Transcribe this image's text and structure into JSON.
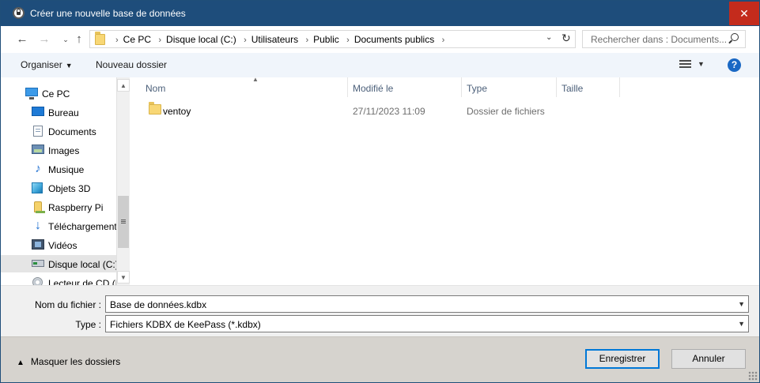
{
  "window": {
    "title": "Créer une nouvelle base de données",
    "close_glyph": "✕"
  },
  "nav": {
    "back_glyph": "←",
    "forward_glyph": "→",
    "up_glyph": "↑",
    "breadcrumbs": [
      "Ce PC",
      "Disque local (C:)",
      "Utilisateurs",
      "Public",
      "Documents publics"
    ],
    "search_placeholder": "Rechercher dans : Documents..."
  },
  "toolbar": {
    "organize_label": "Organiser",
    "new_folder_label": "Nouveau dossier",
    "help_glyph": "?"
  },
  "sidebar": {
    "items": [
      {
        "label": "Ce PC",
        "icon": "pc-icon"
      },
      {
        "label": "Bureau",
        "icon": "desktop-icon"
      },
      {
        "label": "Documents",
        "icon": "documents-icon"
      },
      {
        "label": "Images",
        "icon": "images-icon"
      },
      {
        "label": "Musique",
        "icon": "music-icon"
      },
      {
        "label": "Objets 3D",
        "icon": "objects-3d-icon"
      },
      {
        "label": "Raspberry Pi",
        "icon": "raspberry-pi-icon"
      },
      {
        "label": "Téléchargements",
        "icon": "downloads-icon"
      },
      {
        "label": "Vidéos",
        "icon": "videos-icon"
      },
      {
        "label": "Disque local (C:)",
        "icon": "hard-drive-icon",
        "selected": true
      },
      {
        "label": "Lecteur de CD (D",
        "icon": "cd-drive-icon"
      }
    ]
  },
  "filelist": {
    "columns": [
      "Nom",
      "Modifié le",
      "Type",
      "Taille"
    ],
    "rows": [
      {
        "name": "ventoy",
        "modified": "27/11/2023 11:09",
        "type": "Dossier de fichiers",
        "size": ""
      }
    ]
  },
  "form": {
    "filename_label": "Nom du fichier :",
    "filename_value": "Base de données.kdbx",
    "type_label": "Type :",
    "type_value": "Fichiers KDBX de KeePass (*.kdbx)"
  },
  "footer": {
    "hide_folders_label": "Masquer les dossiers",
    "save_label": "Enregistrer",
    "cancel_label": "Annuler"
  }
}
